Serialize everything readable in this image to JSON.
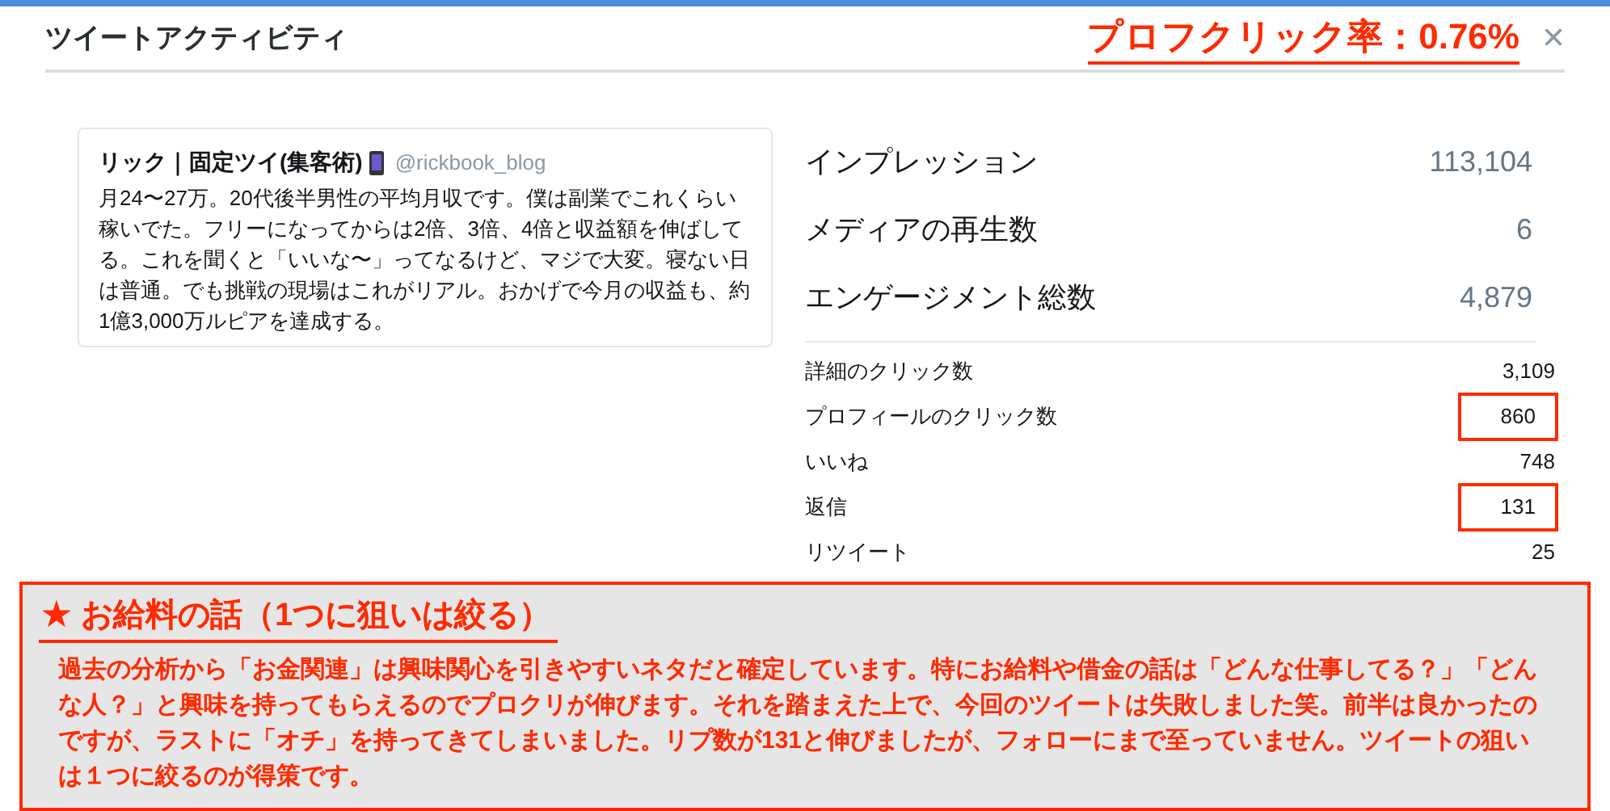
{
  "dialog": {
    "title": "ツイートアクティビティ",
    "annotation": "プロフクリック率：0.76%",
    "close": "×"
  },
  "tweet": {
    "name": "リック｜固定ツイ(集客術)",
    "handle": "@rickbook_blog",
    "text": "月24〜27万。20代後半男性の平均月収です。僕は副業でこれくらい稼いでた。フリーになってからは2倍、3倍、4倍と収益額を伸ばしてる。これを聞くと「いいな〜」ってなるけど、マジで大変。寝ない日は普通。でも挑戦の現場はこれがリアル。おかげで今月の収益も、約1億3,000万ルピアを達成する。"
  },
  "metrics": [
    {
      "label": "インプレッション",
      "value": "113,104"
    },
    {
      "label": "メディアの再生数",
      "value": "6"
    },
    {
      "label": "エンゲージメント総数",
      "value": "4,879"
    }
  ],
  "details": [
    {
      "label": "詳細のクリック数",
      "value": "3,109",
      "highlighted": false
    },
    {
      "label": "プロフィールのクリック数",
      "value": "860",
      "highlighted": true
    },
    {
      "label": "いいね",
      "value": "748",
      "highlighted": false
    },
    {
      "label": "返信",
      "value": "131",
      "highlighted": true
    },
    {
      "label": "リツイート",
      "value": "25",
      "highlighted": false
    }
  ],
  "note": {
    "star": "★",
    "heading": "お給料の話（1つに狙いは絞る）",
    "body": "過去の分析から「お金関連」は興味関心を引きやすいネタだと確定しています。特にお給料や借金の話は「どんな仕事してる？」「どんな人？」と興味を持ってもらえるのでプロクリが伸びます。それを踏まえた上で、今回のツイートは失敗しました笑。前半は良かったのですが、ラストに「オチ」を持ってきてしまいました。リプ数が131と伸びましたが、フォローにまで至っていません。ツイートの狙いは１つに絞るのが得策です。"
  }
}
